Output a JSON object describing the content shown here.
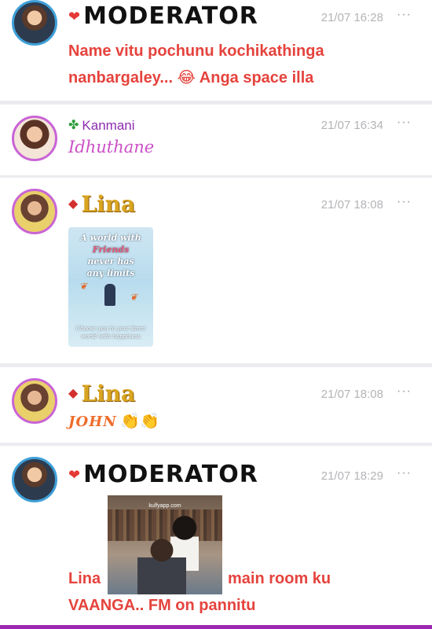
{
  "messages": [
    {
      "sender": "MODERATOR",
      "time": "21/07 16:28",
      "more": "···",
      "line1": "Name vitu pochunu kochikathinga",
      "line2a": "nanbargaley...",
      "line2b": "Anga space illa",
      "emoji": "😂"
    },
    {
      "sender": "Kanmani",
      "time": "21/07 16:34",
      "more": "···",
      "text": "Idhuthane"
    },
    {
      "sender": "Lina",
      "time": "21/07 18:08",
      "more": "···",
      "sticker": {
        "line1": "A world with",
        "line2": "Friends",
        "line3": "never has",
        "line4": "any limits",
        "caption1": "Choose you to your fanni",
        "caption2": "world with happiness"
      }
    },
    {
      "sender": "Lina",
      "time": "21/07 18:08",
      "more": "···",
      "text": "JOHN",
      "emoji": "👏👏"
    },
    {
      "sender": "MODERATOR",
      "time": "21/07 18:29",
      "more": "···",
      "line1a": "Lina",
      "line1b": "main room ku",
      "line2": "VAANGA.. FM on pannitu",
      "gif_watermark": "kulfyapp.com"
    }
  ],
  "colors": {
    "moderator_ring": "#3fa0d8",
    "member_ring": "#c964d6",
    "message_red": "#e5433d",
    "bottom_bar": "#9c27b0"
  }
}
